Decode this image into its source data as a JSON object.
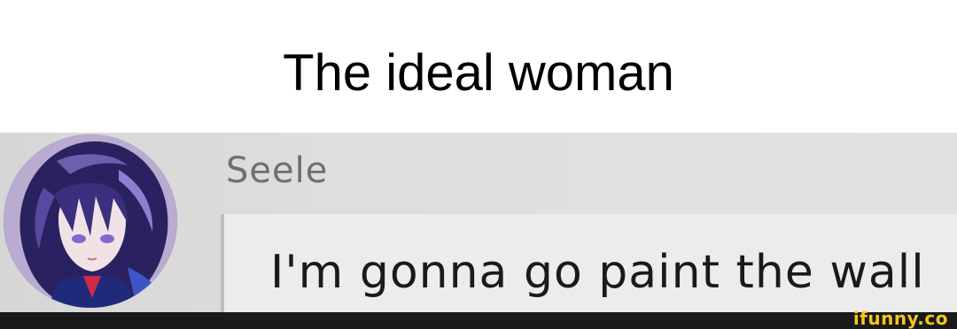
{
  "caption": {
    "text": "The ideal woman"
  },
  "chat": {
    "sender_name": "Seele",
    "message": "I'm gonna go paint the wall"
  },
  "watermark": {
    "text": "ifunny.co",
    "color": "#f4c71a"
  },
  "avatar": {
    "icon": "anime-character-avatar-icon",
    "colors": [
      "#3a2f6e",
      "#6c5fb0",
      "#1c1840"
    ]
  }
}
